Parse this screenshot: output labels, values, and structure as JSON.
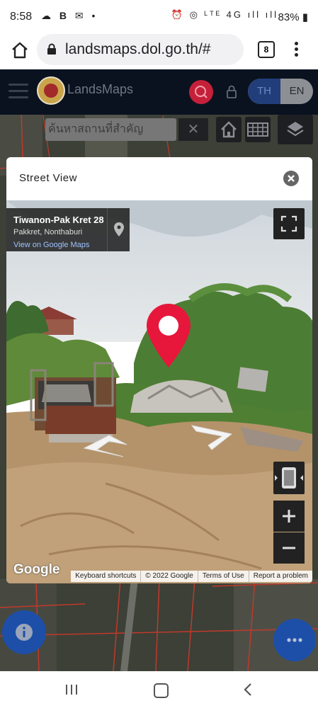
{
  "status_bar": {
    "time": "8:58",
    "left_icons": [
      "cloud-icon",
      "b-icon",
      "mail-icon",
      "dot-icon"
    ],
    "right_icons": [
      "alarm-icon",
      "hotspot-icon",
      "volte-icon",
      "4g-icon",
      "signal-icon",
      "signal-icon"
    ],
    "battery": "83%"
  },
  "browser": {
    "url": "landsmaps.dol.go.th/#",
    "tab_count": "8"
  },
  "app": {
    "title": "LandsMaps",
    "lang_th": "TH",
    "lang_en": "EN",
    "accent": "#c5203a",
    "nav_blue": "#213e7a"
  },
  "map_toolbar": {
    "search_placeholder": "ค้นหาสถานที่สำคัญ",
    "clear_label": "✕"
  },
  "street_view": {
    "dialog_title": "Street View",
    "place_name": "Tiwanon-Pak Kret 28",
    "place_location": "Pakkret, Nonthaburi",
    "maps_link": "View on Google Maps",
    "google_logo": "Google",
    "attribution": [
      "Keyboard shortcuts",
      "© 2022 Google",
      "Terms of Use",
      "Report a problem"
    ]
  },
  "fab_colors": {
    "info": "#1d4fa8",
    "more": "#1d4fa8"
  }
}
